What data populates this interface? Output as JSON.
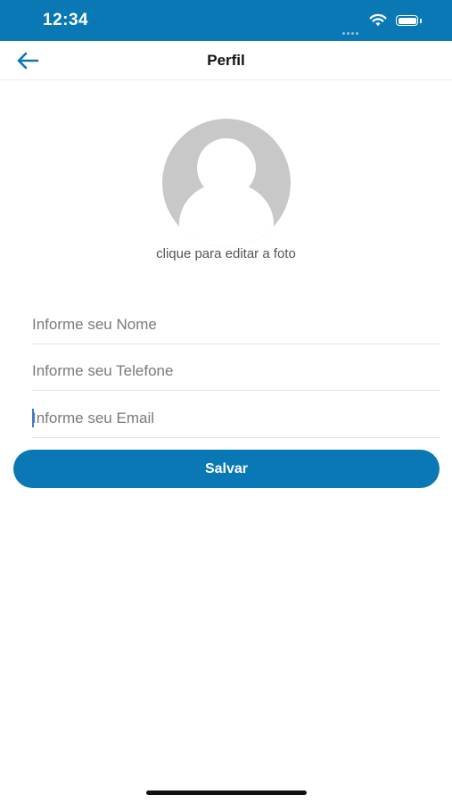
{
  "status_bar": {
    "time": "12:34",
    "color": "#0a78b5"
  },
  "nav": {
    "title": "Perfil",
    "back_icon": "arrow-left-icon"
  },
  "profile": {
    "avatar_icon": "user-placeholder-icon",
    "edit_photo_label": "clique para editar a foto"
  },
  "form": {
    "name_placeholder": "Informe seu Nome",
    "phone_placeholder": "Informe seu Telefone",
    "email_placeholder": "Informe seu Email",
    "name_value": "",
    "phone_value": "",
    "email_value": ""
  },
  "actions": {
    "save_label": "Salvar"
  },
  "colors": {
    "accent": "#0a78b5",
    "avatar_gray": "#c8c8c8"
  }
}
